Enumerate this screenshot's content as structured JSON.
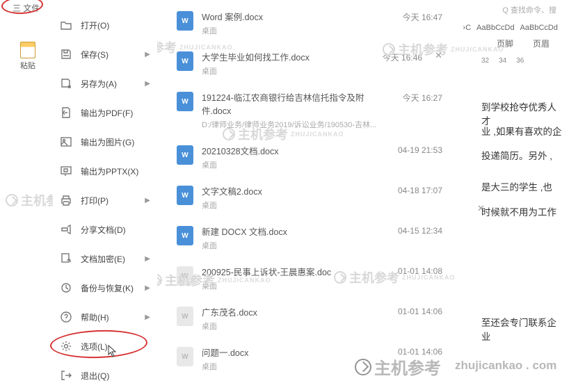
{
  "header": {
    "file_btn": "三 文件",
    "search_placeholder": "Q 查找命令、搜"
  },
  "toolbar": {
    "paste": "粘贴"
  },
  "styles": {
    "s1": "›C",
    "s2": "AaBbCcDd",
    "s3": "AaBbCcDd",
    "l1": "页脚",
    "l2": "页眉"
  },
  "ruler": [
    "32",
    "34",
    "36"
  ],
  "menu": {
    "open": "打开(O)",
    "save": "保存(S)",
    "saveas": "另存为(A)",
    "pdf": "输出为PDF(F)",
    "image": "输出为图片(G)",
    "pptx": "输出为PPTX(X)",
    "print": "打印(P)",
    "share": "分享文档(D)",
    "encrypt": "文档加密(E)",
    "backup": "备份与恢复(K)",
    "help": "帮助(H)",
    "options": "选项(L)",
    "exit": "退出(Q)"
  },
  "files": [
    {
      "name": "Word 案例.docx",
      "path": "桌面",
      "date": "今天 16:47"
    },
    {
      "name": "大学生毕业如何找工作.docx",
      "path": "桌面",
      "date": "今天 16:46"
    },
    {
      "name": "191224-临江农商银行给吉林信托指令及附件.docx",
      "path": "D:/律师业务/律师业务2019/诉讼业务/190530-吉林...",
      "date": "今天 16:27"
    },
    {
      "name": "20210328文档.docx",
      "path": "桌面",
      "date": "04-19 21:53"
    },
    {
      "name": "文字文稿2.docx",
      "path": "桌面",
      "date": "04-18 17:07"
    },
    {
      "name": "新建 DOCX 文档.docx",
      "path": "桌面",
      "date": "04-15 12:34"
    },
    {
      "name": "200925-民事上诉状-王晨惠案.doc",
      "path": "桌面",
      "date": "01-01 14:08"
    },
    {
      "name": "广东茂名.docx",
      "path": "桌面",
      "date": "01-01 14:06"
    },
    {
      "name": "问题一.docx",
      "path": "桌面",
      "date": "01-01 14:06"
    }
  ],
  "doc_lines": [
    "到学校抢夺优秀人才",
    "业 ,如果有喜欢的企",
    "投递简历。另外 ,",
    "是大三的学生 ,也",
    "时候就不用为工作",
    "至还会专门联系企业"
  ],
  "watermark_text": "主机参考",
  "watermark_sub": "ZHUJICANKAO",
  "watermark_url": "zhujicankao . com"
}
